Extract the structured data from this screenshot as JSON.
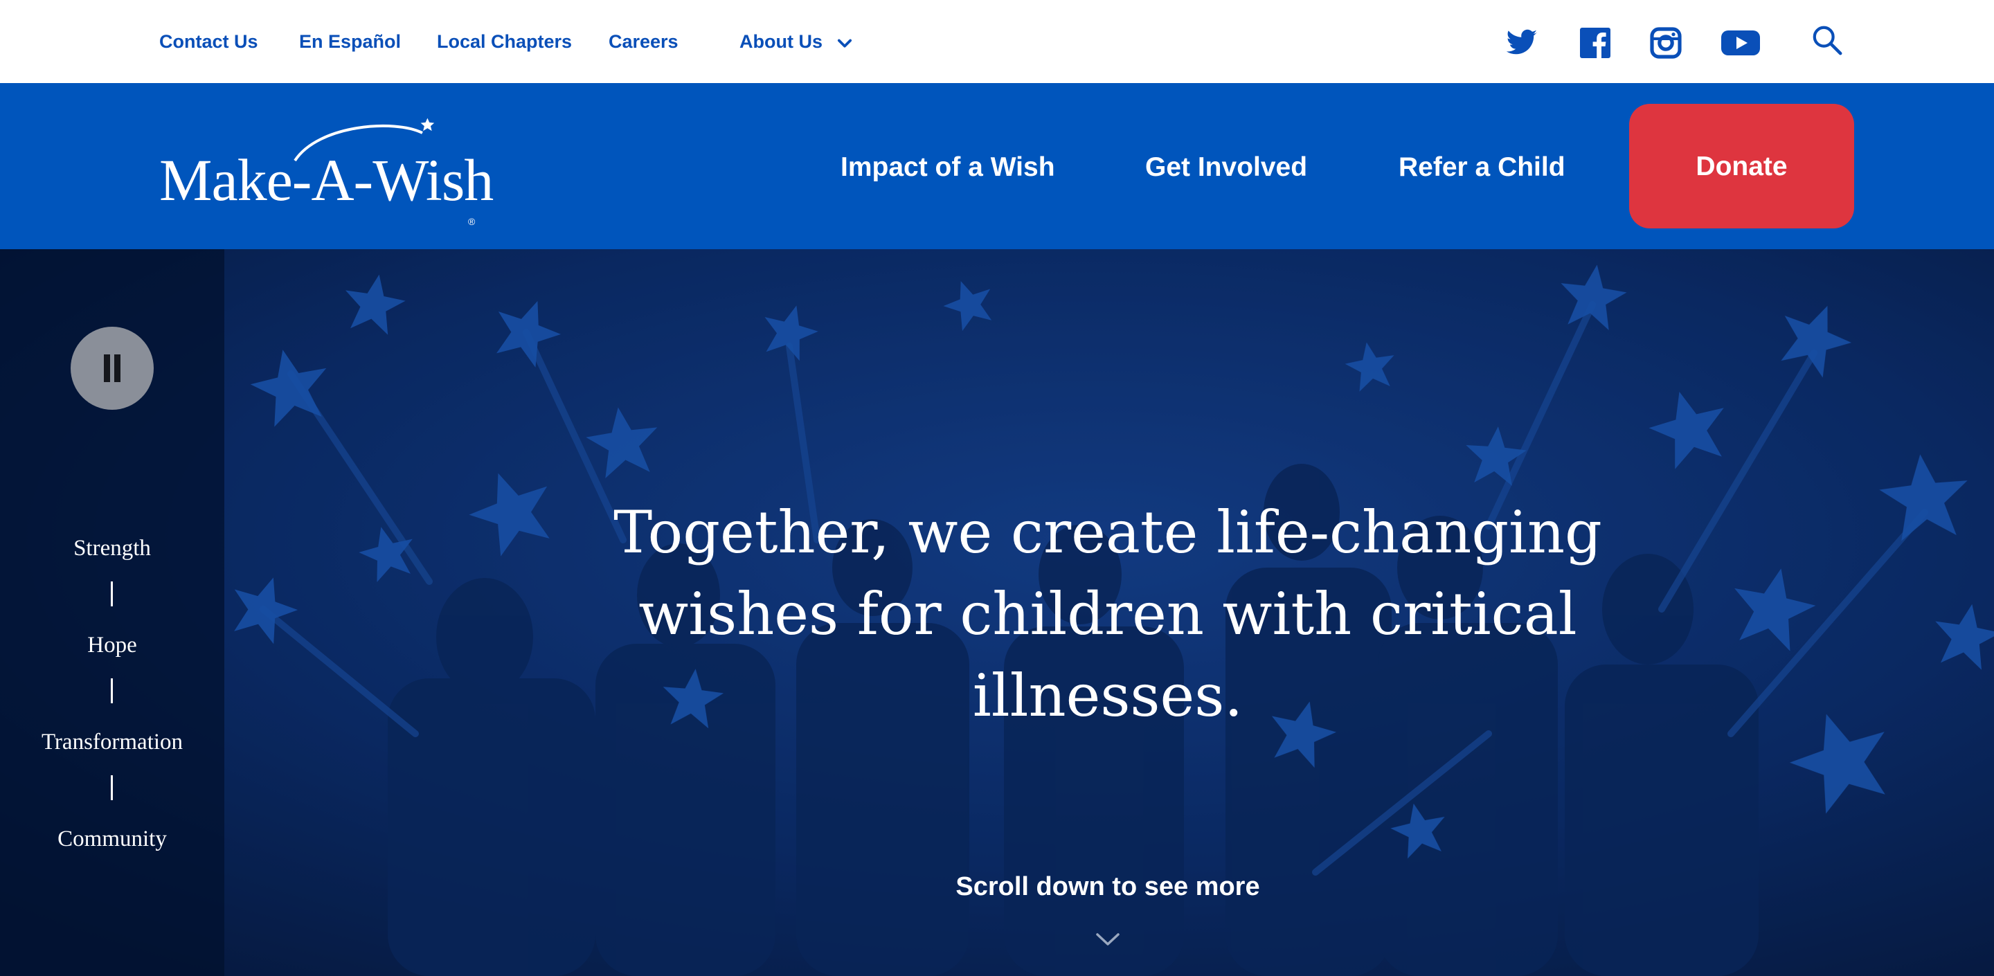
{
  "utility_nav": {
    "links": [
      "Contact Us",
      "En Español",
      "Local Chapters",
      "Careers"
    ],
    "about_label": "About Us",
    "icons": [
      "twitter-icon",
      "facebook-icon",
      "instagram-icon",
      "youtube-icon",
      "search-icon"
    ]
  },
  "main_nav": {
    "logo_text": "Make-A-Wish",
    "logo_mark": "®",
    "items": [
      "Impact of a Wish",
      "Get Involved",
      "Refer a Child"
    ],
    "donate_label": "Donate"
  },
  "hero": {
    "values": [
      "Strength",
      "Hope",
      "Transformation",
      "Community"
    ],
    "headline": "Together, we create life-changing wishes for children with critical illnesses.",
    "scroll_label": "Scroll down to see more"
  },
  "colors": {
    "brand_blue": "#0055bc",
    "link_blue": "#0a4fb8",
    "donate_red": "#de353f",
    "hero_overlay": "#0a2f72"
  }
}
